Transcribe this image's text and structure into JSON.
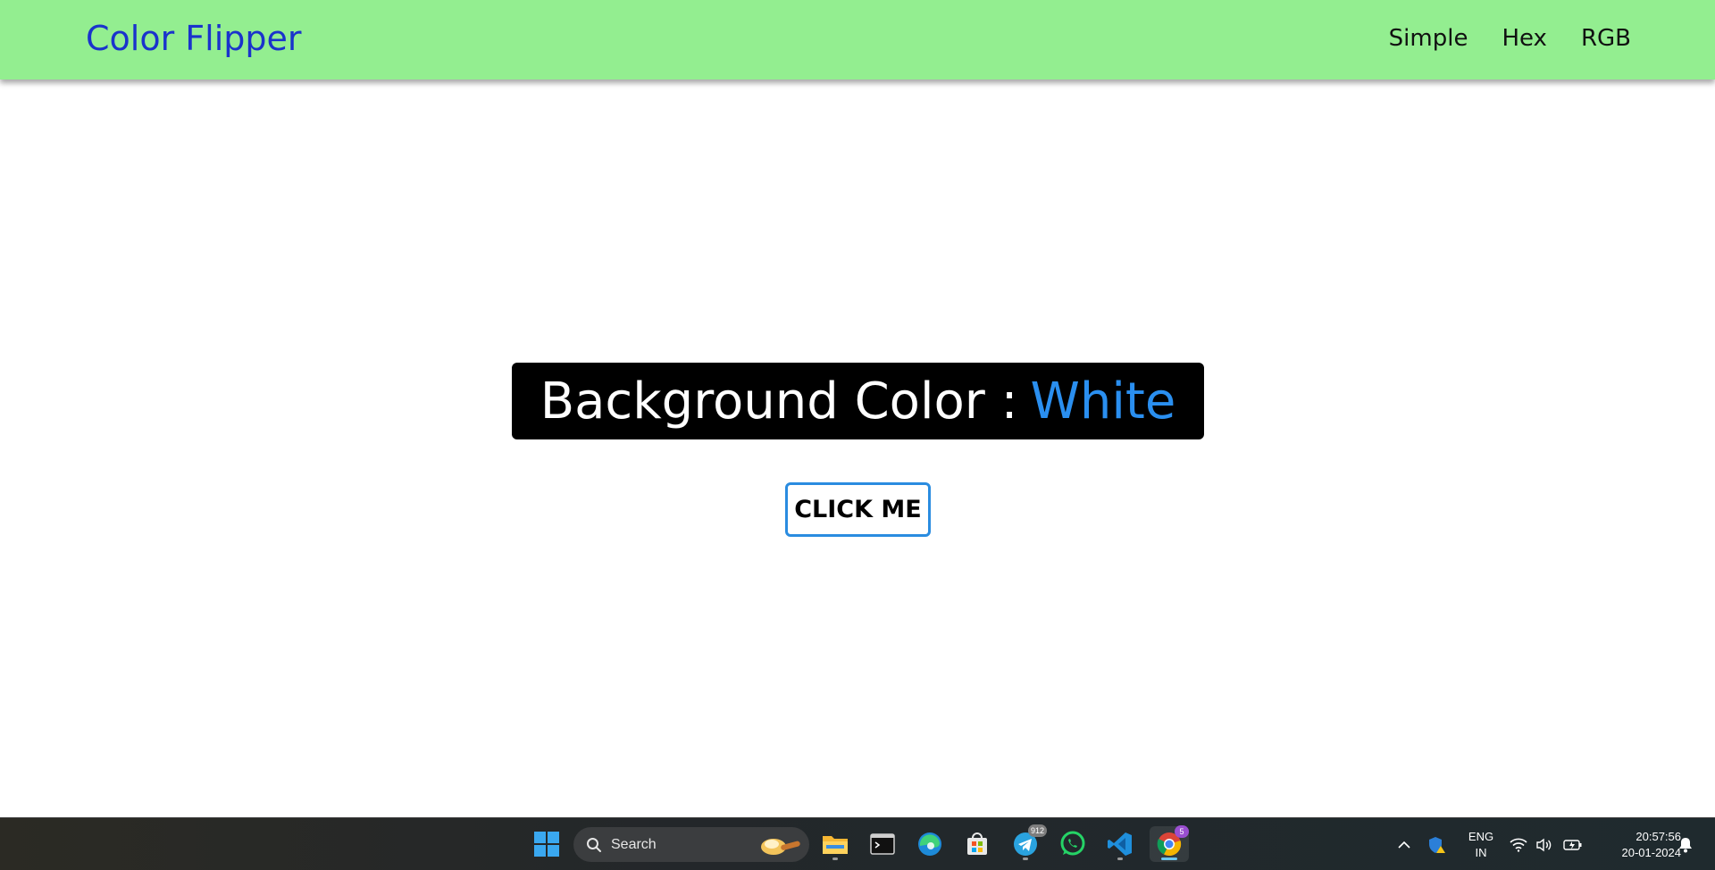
{
  "navbar": {
    "brand": "Color Flipper",
    "links": [
      "Simple",
      "Hex",
      "RGB"
    ]
  },
  "main": {
    "banner_label": "Background Color :",
    "banner_value": "White",
    "button_label": "CLICK ME"
  },
  "taskbar": {
    "search_placeholder": "Search",
    "telegram_badge": "912",
    "chrome_badge": "5",
    "lang_line1": "ENG",
    "lang_line2": "IN",
    "time": "20:57:56",
    "date": "20-01-2024"
  },
  "colors": {
    "navbar_bg": "#93ee90",
    "brand": "#1a33cc",
    "banner_bg": "#000000",
    "banner_value": "#2a8ff0",
    "button_border": "#2a8ce0"
  }
}
